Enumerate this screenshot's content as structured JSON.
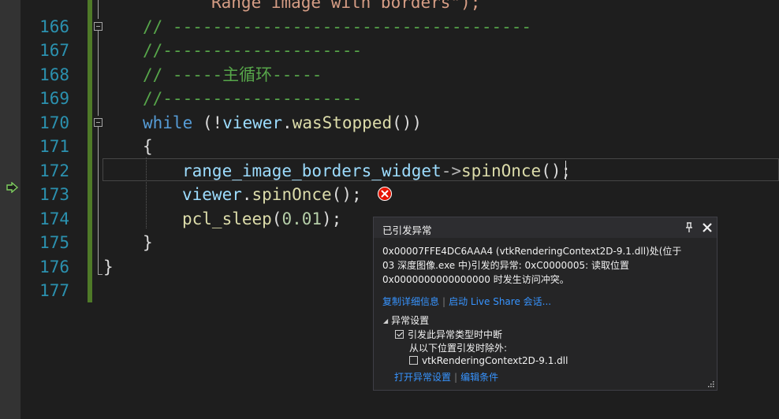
{
  "editor": {
    "line_numbers": [
      "166",
      "167",
      "168",
      "169",
      "170",
      "171",
      "172",
      "173",
      "174",
      "175",
      "176",
      "177"
    ],
    "partial_top_line": "Range image with borders\");",
    "lines": {
      "l166": "// ------------------------------------",
      "l167": "//--------------------",
      "l168": "// -----主循环-----",
      "l169": "//--------------------",
      "l170_kw": "while",
      "l170_a": " (!",
      "l170_obj": "viewer",
      "l170_dot": ".",
      "l170_fn": "wasStopped",
      "l170_b": "())",
      "l171": "{",
      "l172_var": "range_image_borders_widget",
      "l172_op": "->",
      "l172_fn": "spinOnce",
      "l172_end": "();",
      "l173_obj": "viewer",
      "l173_dot": ".",
      "l173_fn": "spinOnce",
      "l173_end": "();",
      "l174_fn": "pcl_sleep",
      "l174_a": "(",
      "l174_num": "0.01",
      "l174_b": ");",
      "l175": "}",
      "l176": "}"
    }
  },
  "exception_popup": {
    "title": "已引发异常",
    "message_line1": "0x00007FFE4DC6AAA4 (vtkRenderingContext2D-9.1.dll)处(位于",
    "message_line2": "03 深度图像.exe 中)引发的异常: 0xC0000005: 读取位置",
    "message_line3": "0x0000000000000000 时发生访问冲突。",
    "link_copy_details": "复制详细信息",
    "link_live_share": "启动 Live Share 会话...",
    "settings_header": "异常设置",
    "break_when_thrown_label": "引发此异常类型时中断",
    "break_when_thrown_checked": true,
    "except_from_label": "从以下位置引发时除外:",
    "module_label": "vtkRenderingContext2D-9.1.dll",
    "module_checked": false,
    "link_open_settings": "打开异常设置",
    "link_edit_conditions": "编辑条件"
  },
  "colors": {
    "comment": "#57a64a",
    "keyword": "#569cd6",
    "function": "#dcdcaa",
    "variable": "#9cdcfe",
    "line_number": "#2b91af",
    "error": "#e51400",
    "link": "#3794ff"
  }
}
